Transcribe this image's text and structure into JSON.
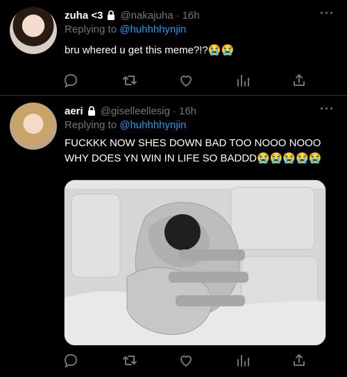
{
  "tweets": [
    {
      "name": "zuha <3",
      "handle": "@nakajuha",
      "time": "16h",
      "replying_prefix": "Replying to",
      "replying_to": "@huhhhhynjin",
      "text": "bru whered u get this meme?!?😭😭"
    },
    {
      "name": "aeri",
      "handle": "@giselleellesig",
      "time": "16h",
      "replying_prefix": "Replying to",
      "replying_to": "@huhhhhynjin",
      "text": "FUCKKK NOW SHES DOWN BAD TOO NOOO NOOO\nWHY DOES YN WIN IN LIFE SO BADDD😭😭😭😭😭"
    }
  ],
  "separator": "·",
  "icons": {
    "reply": "reply-icon",
    "retweet": "retweet-icon",
    "like": "like-icon",
    "analytics": "analytics-icon",
    "share": "share-icon",
    "more": "more-icon",
    "lock": "lock-icon"
  },
  "colors": {
    "background": "#000000",
    "text": "#ffffff",
    "muted": "#71767b",
    "link": "#1d9bf0"
  }
}
